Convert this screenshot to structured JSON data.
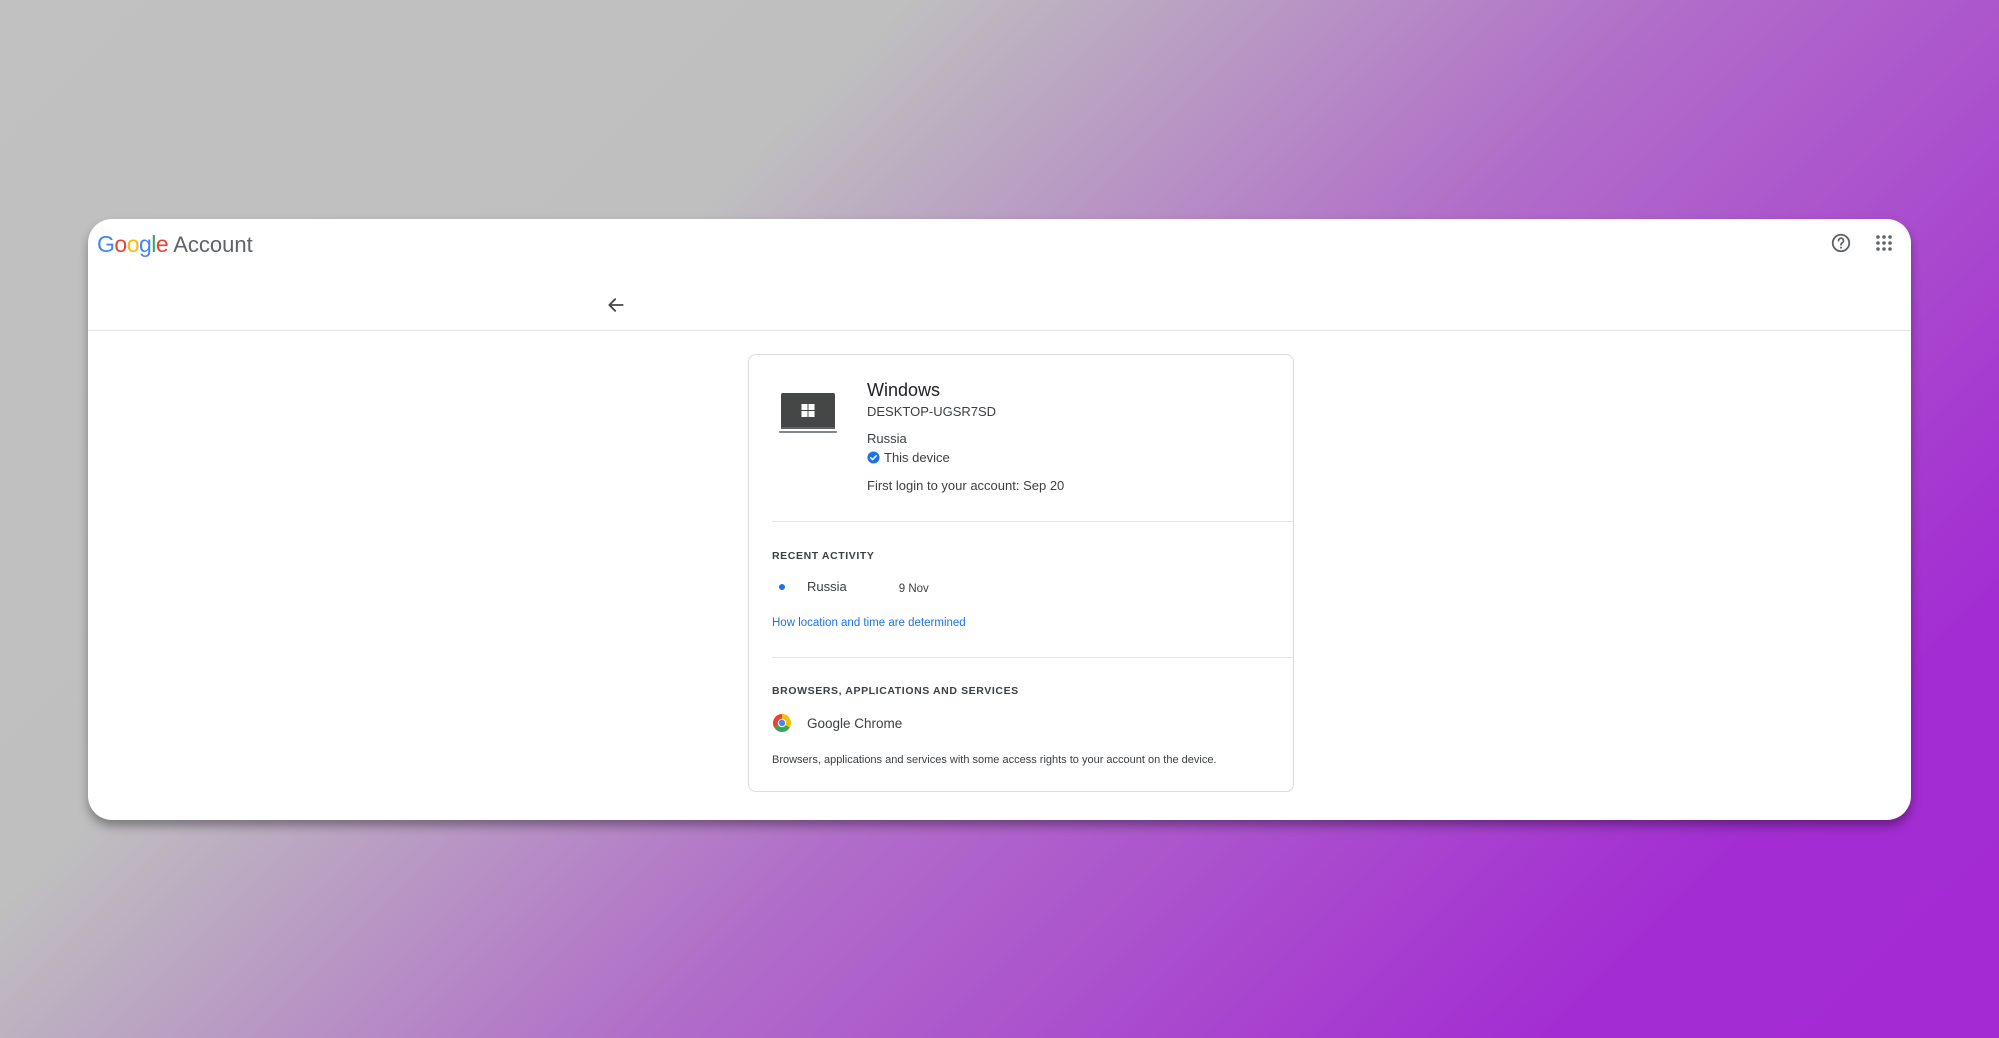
{
  "header": {
    "logo_letters": [
      {
        "char": "G",
        "color": "#4285F4"
      },
      {
        "char": "o",
        "color": "#EA4335"
      },
      {
        "char": "o",
        "color": "#FBBC05"
      },
      {
        "char": "g",
        "color": "#4285F4"
      },
      {
        "char": "l",
        "color": "#34A853"
      },
      {
        "char": "e",
        "color": "#EA4335"
      }
    ],
    "account_label": "Account",
    "help_icon": "help-circle-icon",
    "apps_icon": "apps-grid-icon"
  },
  "nav": {
    "back_icon": "arrow-back-icon"
  },
  "device": {
    "icon": "windows-laptop-icon",
    "os": "Windows",
    "name": "DESKTOP-UGSR7SD",
    "country": "Russia",
    "this_device_label": "This device",
    "first_login": "First login to your account: Sep 20"
  },
  "recent_activity": {
    "title": "RECENT ACTIVITY",
    "items": [
      {
        "location": "Russia",
        "date": "9 Nov"
      }
    ],
    "link": "How location and time are determined"
  },
  "browsers": {
    "title": "BROWSERS, APPLICATIONS AND SERVICES",
    "items": [
      {
        "name": "Google Chrome",
        "icon": "chrome-icon"
      }
    ],
    "note": "Browsers, applications and services with some access rights to your account on the device."
  },
  "colors": {
    "accent": "#1a73e8",
    "text": "#3c4043",
    "divider": "#e3e3e3"
  }
}
